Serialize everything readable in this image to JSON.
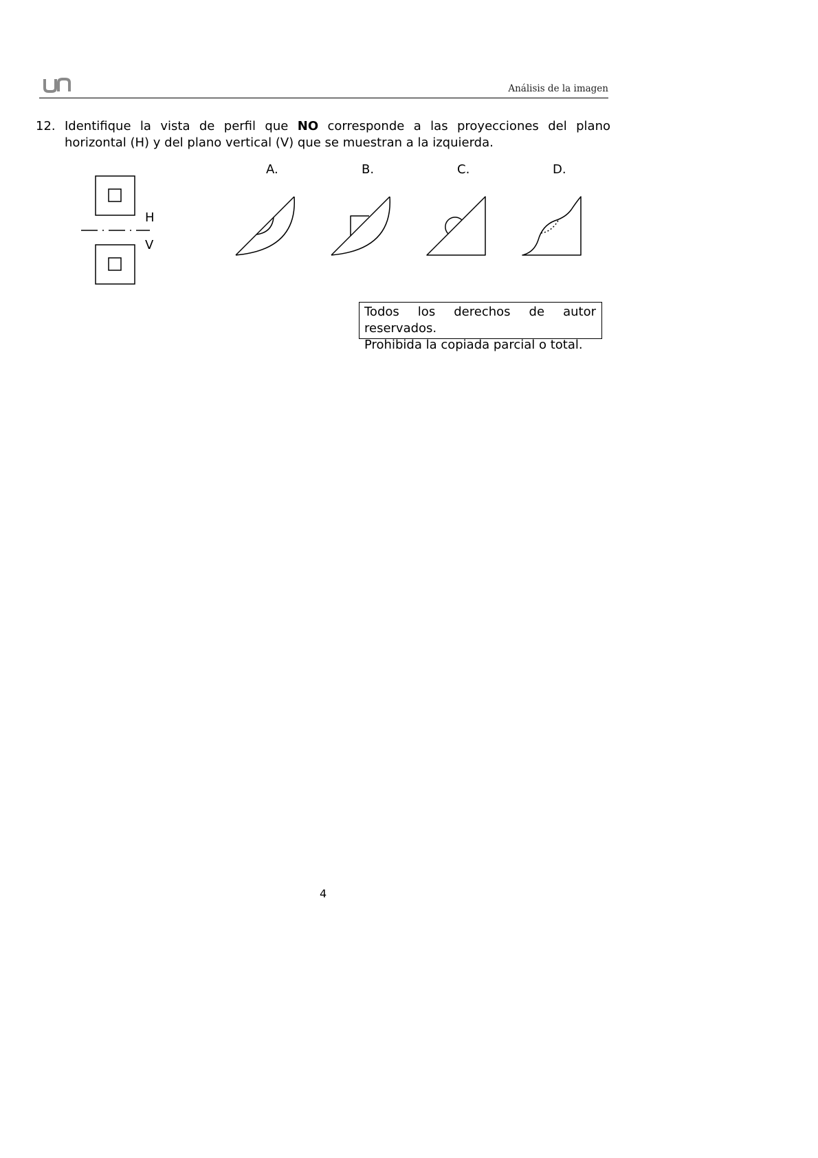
{
  "header": {
    "logo_icon": "un-logo-icon",
    "running_title": "Análisis de la imagen"
  },
  "question": {
    "number": "12.",
    "text_before": "Identifique la vista de perfil que ",
    "emphasis": "NO",
    "text_after": " corresponde a las proyecciones del plano horizontal (H) y del plano vertical (V) que se muestran a la izquierda."
  },
  "projection_labels": {
    "horizontal": "H",
    "vertical": "V"
  },
  "options": [
    {
      "label": "A."
    },
    {
      "label": "B."
    },
    {
      "label": "C."
    },
    {
      "label": "D."
    }
  ],
  "copyright": {
    "line1": "Todos los derechos de autor reservados.",
    "line2": "Prohibida la copiada parcial o total."
  },
  "page_number": "4"
}
